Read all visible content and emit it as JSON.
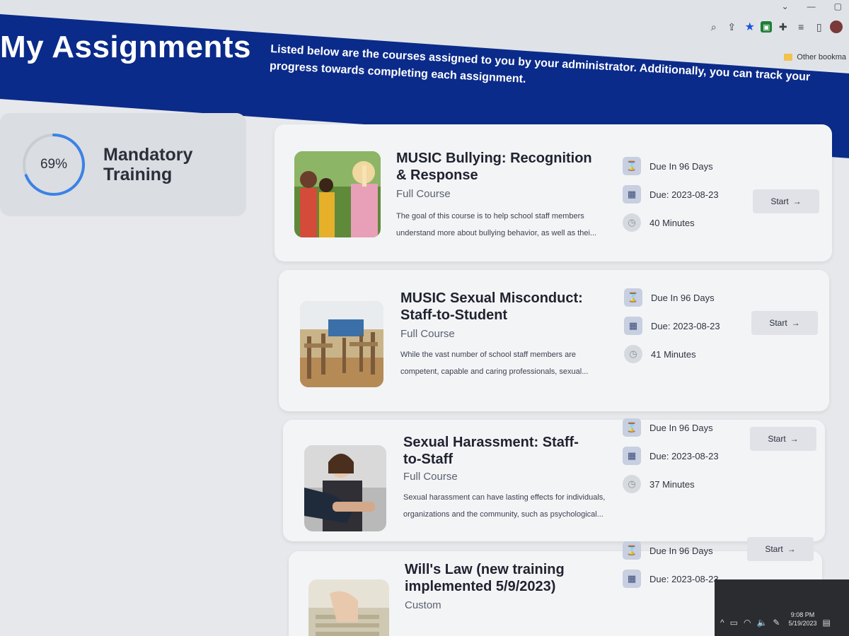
{
  "browser": {
    "bookmarks_label": "Other bookma",
    "icons": [
      "zoom-icon",
      "share-icon",
      "star-icon",
      "extension-icon",
      "puzzle-icon",
      "menu-icon",
      "sidepanel-icon",
      "profile-icon"
    ]
  },
  "header": {
    "title": "My Assignments",
    "description": "Listed below are the courses assigned to you by your administrator. Additionally, you can track your progress towards completing each assignment."
  },
  "progress": {
    "percent_label": "69%",
    "percent": 69,
    "group_title": "Mandatory Training"
  },
  "assignments": [
    {
      "title": "MUSIC Bullying: Recognition & Response",
      "type": "Full Course",
      "description": "The goal of this course is to help school staff members understand more about bullying behavior, as well as thei...",
      "due_in": "Due In 96 Days",
      "due_date": "Due: 2023-08-23",
      "duration": "40 Minutes",
      "button": "Start"
    },
    {
      "title": "MUSIC Sexual Misconduct: Staff-to-Student",
      "type": "Full Course",
      "description": "While the vast number of school staff members are competent, capable and caring professionals, sexual...",
      "due_in": "Due In 96 Days",
      "due_date": "Due: 2023-08-23",
      "duration": "41 Minutes",
      "button": "Start"
    },
    {
      "title": "Sexual Harassment: Staff-to-Staff",
      "type": "Full Course",
      "description": "Sexual harassment can have lasting effects for individuals, organizations and the community, such as psychological...",
      "due_in": "Due In 96 Days",
      "due_date": "Due: 2023-08-23",
      "duration": "37 Minutes",
      "button": "Start"
    },
    {
      "title": "Will's Law (new training implemented 5/9/2023)",
      "type": "Custom",
      "due_in": "Due In 96 Days",
      "due_date": "Due: 2023-08-23",
      "button": "Start"
    }
  ],
  "taskbar": {
    "time": "9:08 PM",
    "date": "5/19/2023"
  },
  "colors": {
    "header_bg": "#0b2b8a",
    "progress_ring": "#3b82e6",
    "card_bg": "#f3f4f6"
  }
}
